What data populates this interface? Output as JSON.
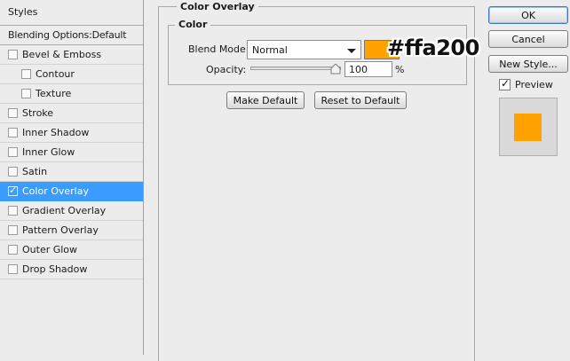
{
  "styles_panel": {
    "header": "Styles",
    "blending_options": "Blending Options:Default",
    "items": [
      {
        "label": "Bevel & Emboss",
        "checked": false,
        "sub": false
      },
      {
        "label": "Contour",
        "checked": false,
        "sub": true
      },
      {
        "label": "Texture",
        "checked": false,
        "sub": true
      },
      {
        "label": "Stroke",
        "checked": false,
        "sub": false
      },
      {
        "label": "Inner Shadow",
        "checked": false,
        "sub": false
      },
      {
        "label": "Inner Glow",
        "checked": false,
        "sub": false
      },
      {
        "label": "Satin",
        "checked": false,
        "sub": false
      },
      {
        "label": "Color Overlay",
        "checked": true,
        "sub": false,
        "selected": true
      },
      {
        "label": "Gradient Overlay",
        "checked": false,
        "sub": false
      },
      {
        "label": "Pattern Overlay",
        "checked": false,
        "sub": false
      },
      {
        "label": "Outer Glow",
        "checked": false,
        "sub": false
      },
      {
        "label": "Drop Shadow",
        "checked": false,
        "sub": false
      }
    ]
  },
  "color_overlay": {
    "title": "Color Overlay",
    "color_group_title": "Color",
    "blend_mode_label": "Blend Mode:",
    "blend_mode_value": "Normal",
    "overlay_color": "#ffa200",
    "hex_annotation": "#ffa200",
    "opacity_label": "Opacity:",
    "opacity_value": "100",
    "opacity_unit": "%",
    "opacity_level": 1.0,
    "make_default_label": "Make Default",
    "reset_default_label": "Reset to Default"
  },
  "right_panel": {
    "ok_label": "OK",
    "cancel_label": "Cancel",
    "new_style_label": "New Style...",
    "preview_label": "Preview",
    "preview_checked": true
  },
  "colors": {
    "selection": "#3b9cff",
    "overlay": "#ffa200"
  }
}
